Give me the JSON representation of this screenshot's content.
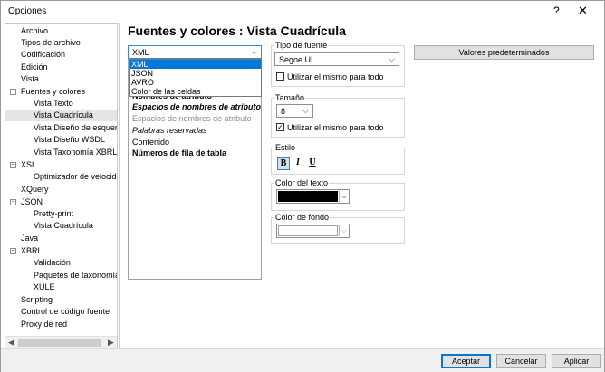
{
  "window": {
    "title": "Opciones",
    "help_glyph": "?",
    "close_glyph": "✕"
  },
  "tree": {
    "items": [
      {
        "label": "Archivo"
      },
      {
        "label": "Tipos de archivo"
      },
      {
        "label": "Codificación"
      },
      {
        "label": "Edición"
      },
      {
        "label": "Vista"
      },
      {
        "label": "Fuentes y colores"
      },
      {
        "label": "Vista Texto"
      },
      {
        "label": "Vista Cuadrícula"
      },
      {
        "label": "Vista Diseño de esquema"
      },
      {
        "label": "Vista Diseño WSDL"
      },
      {
        "label": "Vista Taxonomía XBRL"
      },
      {
        "label": "XSL"
      },
      {
        "label": "Optimizador de velocidad"
      },
      {
        "label": "XQuery"
      },
      {
        "label": "JSON"
      },
      {
        "label": "Pretty-print"
      },
      {
        "label": "Vista Cuadrícula"
      },
      {
        "label": "Java"
      },
      {
        "label": "XBRL"
      },
      {
        "label": "Validación"
      },
      {
        "label": "Paquetes de taxonomía"
      },
      {
        "label": "XULE"
      },
      {
        "label": "Scripting"
      },
      {
        "label": "Control de código fuente"
      },
      {
        "label": "Proxy de red"
      }
    ],
    "expander_minus": "−",
    "scroll_left": "◀",
    "scroll_right": "▶"
  },
  "heading": "Fuentes y colores : Vista Cuadrícula",
  "format_select": {
    "value": "XML",
    "options": [
      "XML",
      "JSON",
      "AVRO",
      "Color de las celdas"
    ]
  },
  "syntax_items": [
    "Nombres de atributo",
    "Espacios de nombres de atributo",
    "Espacios de nombres de atributo",
    "Palabras reservadas",
    "Contenido",
    "Números de fila de tabla"
  ],
  "font": {
    "group_label": "Tipo de fuente",
    "value": "Segoe UI",
    "same_for_all": "Utilizar el mismo para todo",
    "same_checked": false
  },
  "size": {
    "group_label": "Tamaño",
    "value": "8",
    "same_for_all": "Utilizar el mismo para todo",
    "same_checked": true
  },
  "style": {
    "group_label": "Estilo",
    "bold": "B",
    "italic": "I",
    "underline": "U"
  },
  "text_color": {
    "group_label": "Color del texto",
    "color": "#000000"
  },
  "bg_color": {
    "group_label": "Color de fondo",
    "color": "#ffffff"
  },
  "defaults_button": "Valores predeterminados",
  "footer": {
    "accept": "Aceptar",
    "cancel": "Cancelar",
    "apply": "Aplicar"
  },
  "colors": {
    "accent": "#0078d7",
    "selection": "#e5e5e5",
    "button_face": "#e1e1e1"
  }
}
